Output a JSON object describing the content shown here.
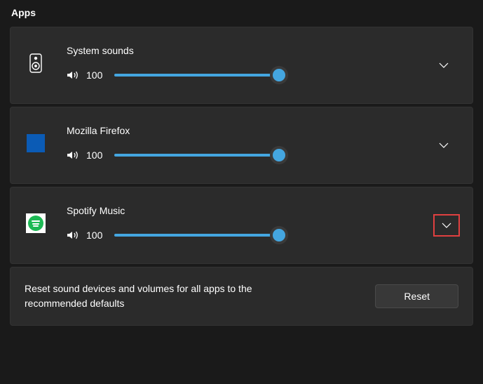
{
  "section_title": "Apps",
  "apps": [
    {
      "name": "System sounds",
      "volume": 100
    },
    {
      "name": "Mozilla Firefox",
      "volume": 100
    },
    {
      "name": "Spotify Music",
      "volume": 100
    }
  ],
  "reset": {
    "description": "Reset sound devices and volumes for all apps to the recommended defaults",
    "button_label": "Reset"
  }
}
